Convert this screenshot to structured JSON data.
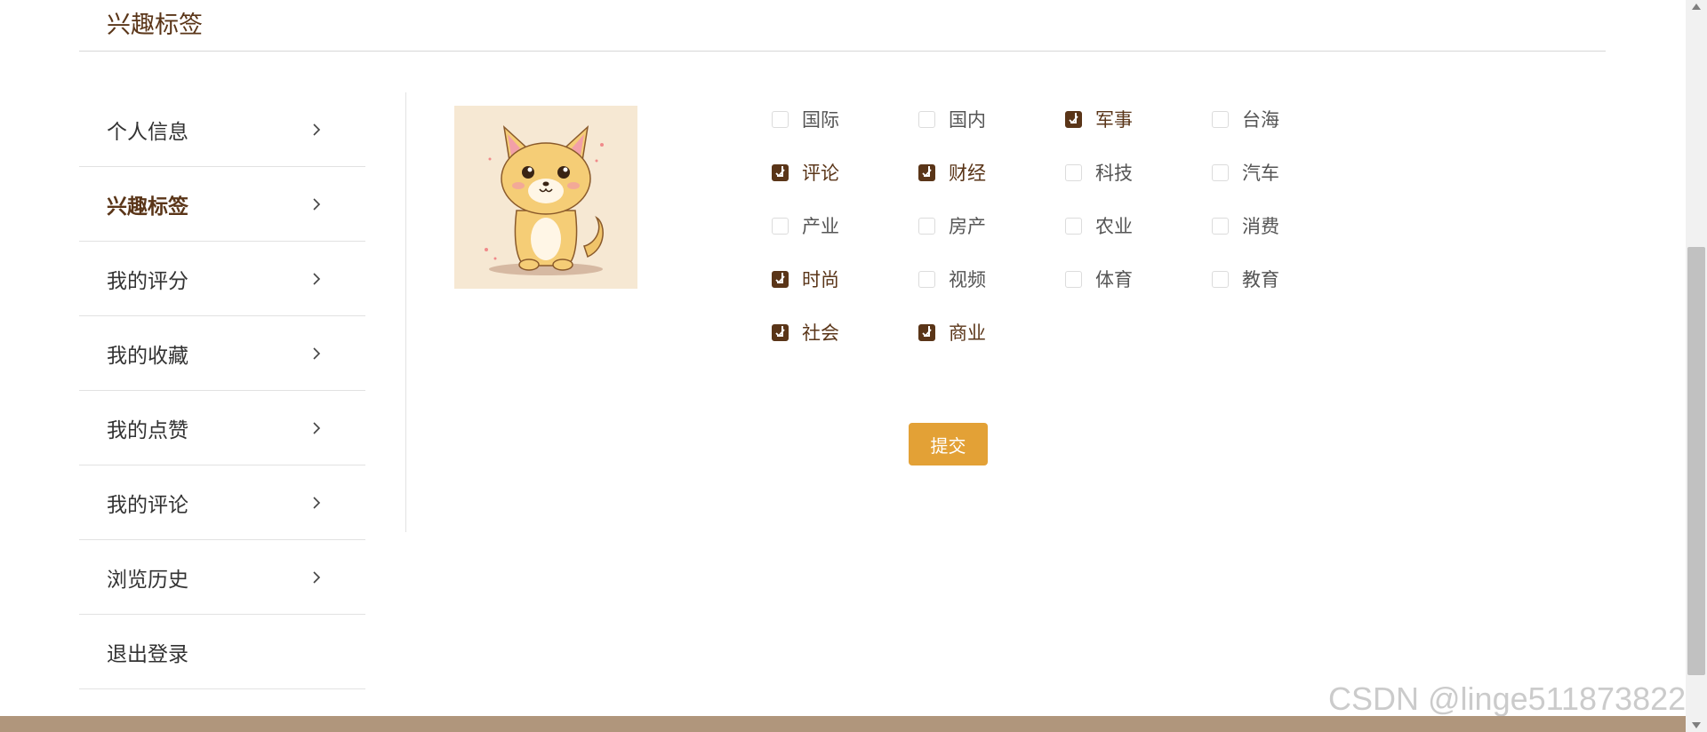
{
  "section": {
    "title": "兴趣标签"
  },
  "sidebar": {
    "items": [
      {
        "label": "个人信息",
        "active": false,
        "chevron": "chevron-right-icon"
      },
      {
        "label": "兴趣标签",
        "active": true,
        "chevron": "chevron-right-icon"
      },
      {
        "label": "我的评分",
        "active": false,
        "chevron": "chevron-right-icon"
      },
      {
        "label": "我的收藏",
        "active": false,
        "chevron": "chevron-right-icon"
      },
      {
        "label": "我的点赞",
        "active": false,
        "chevron": "chevron-right-icon"
      },
      {
        "label": "我的评论",
        "active": false,
        "chevron": "chevron-right-icon"
      },
      {
        "label": "浏览历史",
        "active": false,
        "chevron": "chevron-right-icon"
      },
      {
        "label": "退出登录",
        "active": false
      }
    ]
  },
  "avatar": {
    "icon": "cartoon-kitten-avatar"
  },
  "tags": [
    {
      "label": "国际",
      "checked": false
    },
    {
      "label": "国内",
      "checked": false
    },
    {
      "label": "军事",
      "checked": true
    },
    {
      "label": "台海",
      "checked": false
    },
    {
      "label": "评论",
      "checked": true
    },
    {
      "label": "财经",
      "checked": true
    },
    {
      "label": "科技",
      "checked": false
    },
    {
      "label": "汽车",
      "checked": false
    },
    {
      "label": "产业",
      "checked": false
    },
    {
      "label": "房产",
      "checked": false
    },
    {
      "label": "农业",
      "checked": false
    },
    {
      "label": "消费",
      "checked": false
    },
    {
      "label": "时尚",
      "checked": true
    },
    {
      "label": "视频",
      "checked": false
    },
    {
      "label": "体育",
      "checked": false
    },
    {
      "label": "教育",
      "checked": false
    },
    {
      "label": "社会",
      "checked": true
    },
    {
      "label": "商业",
      "checked": true
    }
  ],
  "submit": {
    "label": "提交"
  },
  "watermark": {
    "text": "CSDN @linge511873822"
  },
  "colors": {
    "accent_brown": "#5a3518",
    "button_orange": "#e3a136",
    "footer_brown": "#b0967c"
  }
}
